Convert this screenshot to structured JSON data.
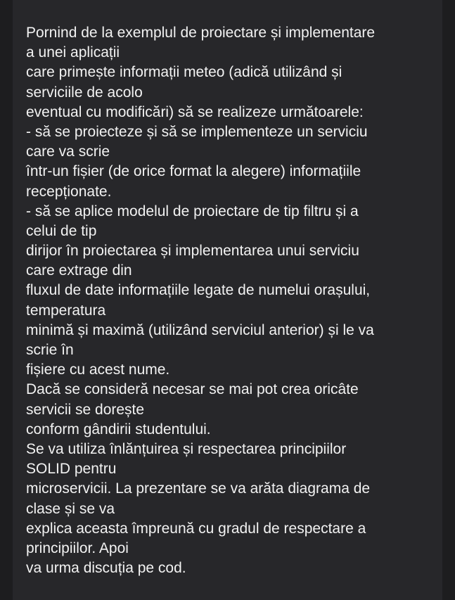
{
  "message": {
    "lines": [
      "Pornind de la exemplul de proiectare și implementare",
      "a unei aplicații",
      "care primește informații meteo (adică utilizând și",
      "serviciile de acolo",
      "eventual cu modificări) să se realizeze următoarele:",
      "- să se proiecteze și să se implementeze un serviciu",
      "care va scrie",
      "într-un fișier (de orice format la alegere) informațiile",
      "recepționate.",
      "- să se aplice modelul de proiectare de tip filtru și a",
      "celui de tip",
      "dirijor în proiectarea și implementarea unui serviciu",
      "care extrage din",
      "fluxul de date informațiile legate de numelui orașului,",
      "temperatura",
      "minimă și maximă (utilizând serviciul anterior) și le va",
      "scrie în",
      "fișiere cu acest nume.",
      "Dacă se consideră necesar se mai pot crea oricâte",
      "servicii se dorește",
      "conform gândirii studentului.",
      "Se va utiliza înlănțuirea și respectarea principiilor",
      "SOLID pentru",
      "microservicii. La prezentare se va arăta diagrama de",
      "clase și se va",
      "explica aceasta împreună cu gradul de respectare a",
      "principiilor. Apoi",
      "va urma discuția pe cod."
    ]
  },
  "colors": {
    "background": "#1d1d1f",
    "panel": "#27272a",
    "text": "#f2f2f2"
  }
}
